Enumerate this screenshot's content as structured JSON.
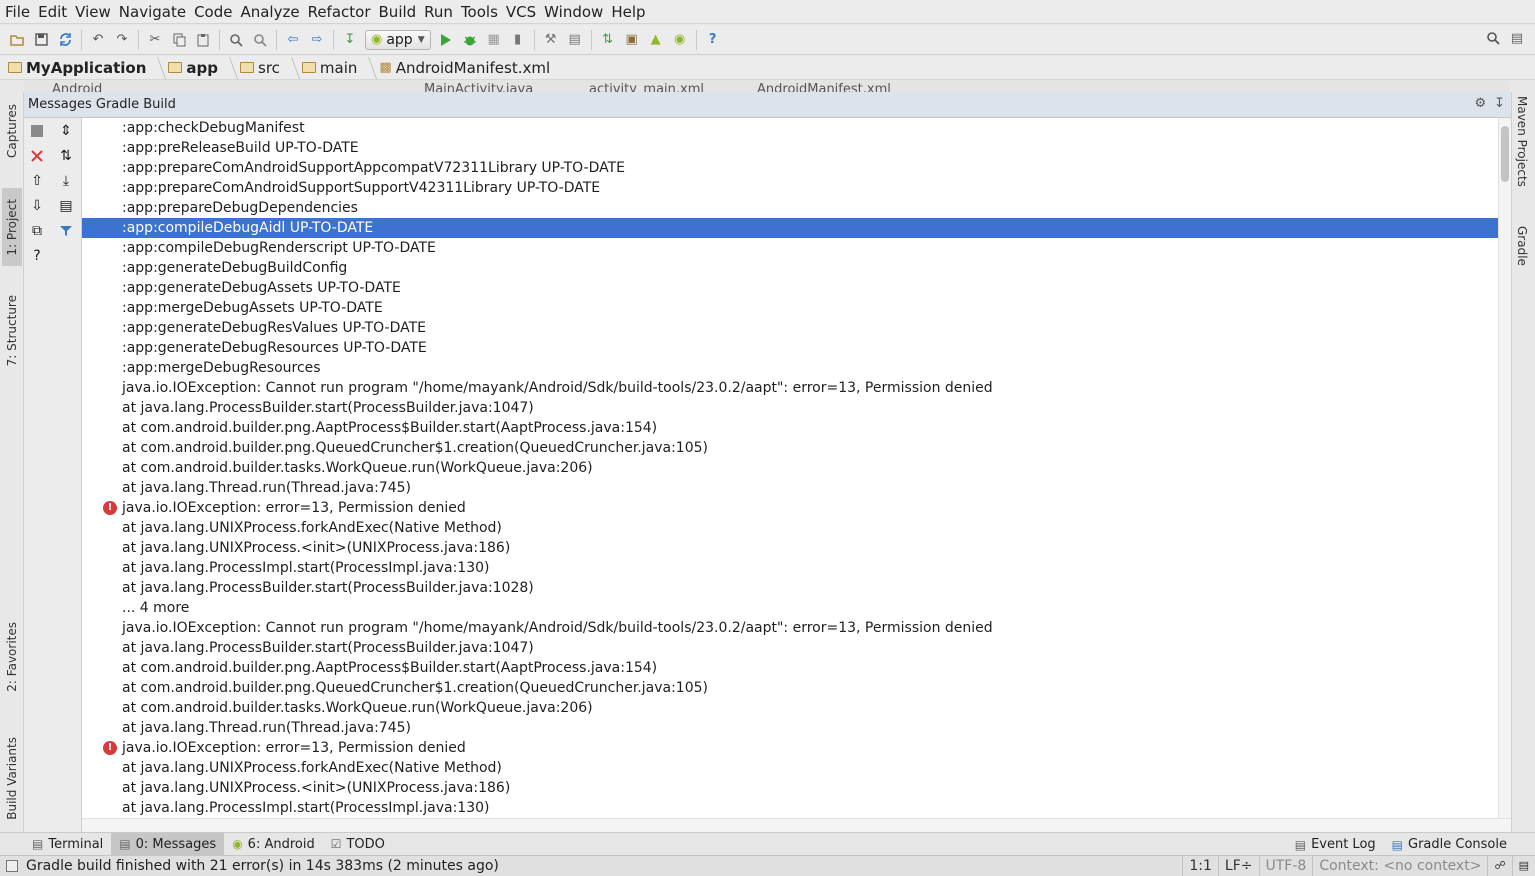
{
  "menu": [
    "File",
    "Edit",
    "View",
    "Navigate",
    "Code",
    "Analyze",
    "Refactor",
    "Build",
    "Run",
    "Tools",
    "VCS",
    "Window",
    "Help"
  ],
  "toolbar": {
    "run_config": "app"
  },
  "breadcrumb": [
    "MyApplication",
    "app",
    "src",
    "main",
    "AndroidManifest.xml"
  ],
  "editor_tabs": [
    "Android",
    "MainActivity.java",
    "activity_main.xml",
    "AndroidManifest.xml"
  ],
  "left_tool_tabs": [
    "Captures",
    "1: Project",
    "7: Structure",
    "2: Favorites",
    "Build Variants"
  ],
  "right_tool_tabs": [
    "Maven Projects",
    "Gradle"
  ],
  "panel": {
    "title": "Messages Gradle Build"
  },
  "log": [
    {
      "text": ":app:checkDebugManifest",
      "error": false,
      "selected": false
    },
    {
      "text": ":app:preReleaseBuild UP-TO-DATE",
      "error": false,
      "selected": false
    },
    {
      "text": ":app:prepareComAndroidSupportAppcompatV72311Library UP-TO-DATE",
      "error": false,
      "selected": false
    },
    {
      "text": ":app:prepareComAndroidSupportSupportV42311Library UP-TO-DATE",
      "error": false,
      "selected": false
    },
    {
      "text": ":app:prepareDebugDependencies",
      "error": false,
      "selected": false
    },
    {
      "text": ":app:compileDebugAidl UP-TO-DATE",
      "error": false,
      "selected": true
    },
    {
      "text": ":app:compileDebugRenderscript UP-TO-DATE",
      "error": false,
      "selected": false
    },
    {
      "text": ":app:generateDebugBuildConfig",
      "error": false,
      "selected": false
    },
    {
      "text": ":app:generateDebugAssets UP-TO-DATE",
      "error": false,
      "selected": false
    },
    {
      "text": ":app:mergeDebugAssets UP-TO-DATE",
      "error": false,
      "selected": false
    },
    {
      "text": ":app:generateDebugResValues UP-TO-DATE",
      "error": false,
      "selected": false
    },
    {
      "text": ":app:generateDebugResources UP-TO-DATE",
      "error": false,
      "selected": false
    },
    {
      "text": ":app:mergeDebugResources",
      "error": false,
      "selected": false
    },
    {
      "text": "java.io.IOException: Cannot run program \"/home/mayank/Android/Sdk/build-tools/23.0.2/aapt\": error=13, Permission denied",
      "error": false,
      "selected": false
    },
    {
      "text": "at java.lang.ProcessBuilder.start(ProcessBuilder.java:1047)",
      "error": false,
      "selected": false
    },
    {
      "text": "at com.android.builder.png.AaptProcess$Builder.start(AaptProcess.java:154)",
      "error": false,
      "selected": false
    },
    {
      "text": "at com.android.builder.png.QueuedCruncher$1.creation(QueuedCruncher.java:105)",
      "error": false,
      "selected": false
    },
    {
      "text": "at com.android.builder.tasks.WorkQueue.run(WorkQueue.java:206)",
      "error": false,
      "selected": false
    },
    {
      "text": "at java.lang.Thread.run(Thread.java:745)",
      "error": false,
      "selected": false
    },
    {
      "text": "java.io.IOException: error=13, Permission denied",
      "error": true,
      "selected": false
    },
    {
      "text": "at java.lang.UNIXProcess.forkAndExec(Native Method)",
      "error": false,
      "selected": false
    },
    {
      "text": "at java.lang.UNIXProcess.<init>(UNIXProcess.java:186)",
      "error": false,
      "selected": false
    },
    {
      "text": "at java.lang.ProcessImpl.start(ProcessImpl.java:130)",
      "error": false,
      "selected": false
    },
    {
      "text": "at java.lang.ProcessBuilder.start(ProcessBuilder.java:1028)",
      "error": false,
      "selected": false
    },
    {
      "text": "... 4 more",
      "error": false,
      "selected": false
    },
    {
      "text": "java.io.IOException: Cannot run program \"/home/mayank/Android/Sdk/build-tools/23.0.2/aapt\": error=13, Permission denied",
      "error": false,
      "selected": false
    },
    {
      "text": "at java.lang.ProcessBuilder.start(ProcessBuilder.java:1047)",
      "error": false,
      "selected": false
    },
    {
      "text": "at com.android.builder.png.AaptProcess$Builder.start(AaptProcess.java:154)",
      "error": false,
      "selected": false
    },
    {
      "text": "at com.android.builder.png.QueuedCruncher$1.creation(QueuedCruncher.java:105)",
      "error": false,
      "selected": false
    },
    {
      "text": "at com.android.builder.tasks.WorkQueue.run(WorkQueue.java:206)",
      "error": false,
      "selected": false
    },
    {
      "text": "at java.lang.Thread.run(Thread.java:745)",
      "error": false,
      "selected": false
    },
    {
      "text": "java.io.IOException: error=13, Permission denied",
      "error": true,
      "selected": false
    },
    {
      "text": "at java.lang.UNIXProcess.forkAndExec(Native Method)",
      "error": false,
      "selected": false
    },
    {
      "text": "at java.lang.UNIXProcess.<init>(UNIXProcess.java:186)",
      "error": false,
      "selected": false
    },
    {
      "text": "at java.lang.ProcessImpl.start(ProcessImpl.java:130)",
      "error": false,
      "selected": false
    }
  ],
  "bottom_tabs": {
    "terminal": "Terminal",
    "messages": "0: Messages",
    "android": "6: Android",
    "todo": "TODO",
    "event_log": "Event Log",
    "gradle_console": "Gradle Console"
  },
  "status": {
    "message": "Gradle build finished with 21 error(s) in 14s 383ms (2 minutes ago)",
    "position": "1:1",
    "line_sep": "LF÷",
    "encoding": "UTF-8",
    "context": "Context: <no context>"
  },
  "colors": {
    "selection": "#3d73d0",
    "error": "#d63b3b",
    "android_green": "#8fb824"
  },
  "icons": [
    "folder-open-icon",
    "save-icon",
    "sync-icon",
    "undo-icon",
    "redo-icon",
    "cut-icon",
    "copy-icon",
    "paste-icon",
    "find-icon",
    "replace-icon",
    "back-icon",
    "forward-icon",
    "make-icon",
    "run-icon",
    "debug-icon",
    "coverage-icon",
    "attach-debugger-icon",
    "project-structure-icon",
    "sdk-manager-icon",
    "avd-manager-icon",
    "device-monitor-icon",
    "android-icon",
    "help-icon",
    "search-everywhere-icon"
  ]
}
